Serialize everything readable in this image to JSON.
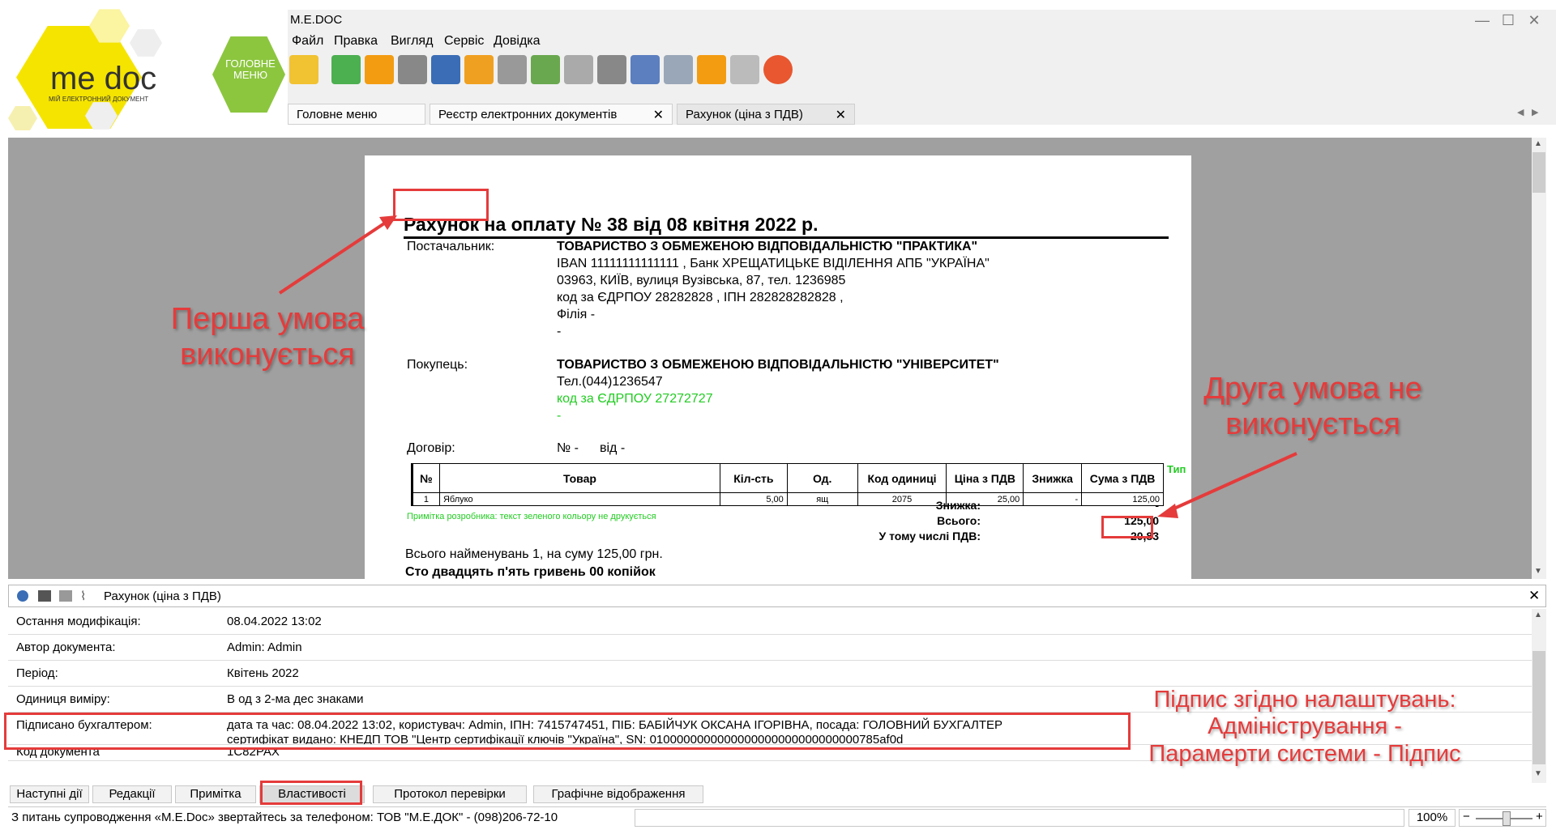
{
  "logo": {
    "brand": "me doc",
    "tagline": "МІЙ ЕЛЕКТРОННИЙ ДОКУМЕНТ",
    "home_label_line1": "ГОЛОВНЕ",
    "home_label_line2": "МЕНЮ"
  },
  "window": {
    "title": "M.E.DOC",
    "minimize": "—",
    "maximize": "☐",
    "close": "✕"
  },
  "menu": [
    "Файл",
    "Правка",
    "Вигляд",
    "Сервіс",
    "Довідка"
  ],
  "toolbar_icons": [
    "new-doc",
    "copy",
    "send",
    "archive",
    "print",
    "export",
    "search",
    "check",
    "refresh",
    "inbox",
    "find",
    "shield",
    "help",
    "chat",
    "speech"
  ],
  "tabs": [
    {
      "label": "Головне меню",
      "closable": false
    },
    {
      "label": "Реєстр електронних документів",
      "closable": true
    },
    {
      "label": "Рахунок (ціна з ПДВ)",
      "closable": true
    }
  ],
  "tab_close": "✕",
  "tab_nav": {
    "left": "◀",
    "right": "▶"
  },
  "document": {
    "title_word": "Рахунок",
    "title_rest": "на оплату № 38 від 08 квітня 2022 р.",
    "supplier_label": "Постачальник:",
    "supplier_lines": [
      "ТОВАРИСТВО З ОБМЕЖЕНОЮ ВІДПОВІДАЛЬНІСТЮ \"ПРАКТИКА\"",
      "IBAN 11111111111111 , Банк ХРЕЩАТИЦЬКЕ ВІДІЛЕННЯ АПБ \"УКРАЇНА\"",
      "03963, КИЇВ, вулиця Вузівська, 87, тел. 1236985",
      "код за ЄДРПОУ 28282828 , ІПН 282828282828 ,",
      "Філія -",
      "-"
    ],
    "buyer_label": "Покупець:",
    "buyer_lines": [
      "ТОВАРИСТВО З ОБМЕЖЕНОЮ ВІДПОВІДАЛЬНІСТЮ \"УНІВЕРСИТЕТ\"",
      "Тел.(044)1236547",
      "код за ЄДРПОУ 27272727",
      "-"
    ],
    "contract_label": "Договір:",
    "contract_no": "№ -",
    "contract_date": "від -",
    "table_headers": [
      "№",
      "Товар",
      "Кіл-сть",
      "Од.",
      "Код одиниці",
      "Ціна з ПДВ",
      "Знижка",
      "Сума з ПДВ"
    ],
    "table_rows": [
      [
        "1",
        "Яблуко",
        "5,00",
        "ящ",
        "2075",
        "25,00",
        "-",
        "125,00"
      ]
    ],
    "side_note": "Тип",
    "dev_note": "Примітка розробника: текст зеленого кольору не друкується",
    "discount_label": "Знижка:",
    "discount_value": "-",
    "total_label": "Всього:",
    "total_value": "125,00",
    "vat_label": "У тому числі ПДВ:",
    "vat_value": "20,83",
    "summary_line": "Всього найменувань 1, на суму 125,00 грн.",
    "amount_words": "Сто двадцять п'ять гривень 00 копійок"
  },
  "properties": {
    "header_title": "Рахунок (ціна з ПДВ)",
    "close": "✕",
    "rows": [
      {
        "label": "Остання модифікація:",
        "value": "08.04.2022 13:02"
      },
      {
        "label": "Автор документа:",
        "value": "Admin: Admin"
      },
      {
        "label": "Період:",
        "value": "Квітень 2022"
      },
      {
        "label": "Одиниця виміру:",
        "value": "В од з 2-ма дес знаками"
      },
      {
        "label": "Підписано бухгалтером:",
        "value": "дата та час: 08.04.2022 13:02, користувач: Admin, ІПН: 7415747451, ПІБ: БАБІЙЧУК ОКСАНА ІГОРІВНА, посада: ГОЛОВНИЙ БУХГАЛТЕР",
        "value2": "сертифікат видано: КНЕДП ТОВ \"Центр сертифікації ключів \"Україна\", SN: 0100000000000000000000000000000785af0d"
      },
      {
        "label": "Код документа",
        "value": "1С82РАХ"
      }
    ]
  },
  "bottom_tabs": [
    "Наступні дії",
    "Редакції",
    "Примітка",
    "Властивості",
    "Протокол перевірки",
    "Графічне відображення"
  ],
  "status": {
    "support_text": "З питань супроводження «M.E.Doc» звертайтесь за телефоном: ТОВ \"М.Е.ДОК\" - (098)206-72-10",
    "zoom": "100%",
    "zoom_minus": "−",
    "zoom_plus": "+"
  },
  "annotations": {
    "first": [
      "Перша умова",
      "виконується"
    ],
    "second": [
      "Друга умова не",
      "виконується"
    ],
    "third": [
      "Підпис згідно налаштувань:",
      "Адміністрування -",
      "Парамерти системи - Підпис"
    ]
  },
  "colors": {
    "annotation_red": "#e53b3b",
    "green_text": "#22cc22",
    "logo_yellow": "#f2e200",
    "logo_green": "#8cc63f"
  }
}
